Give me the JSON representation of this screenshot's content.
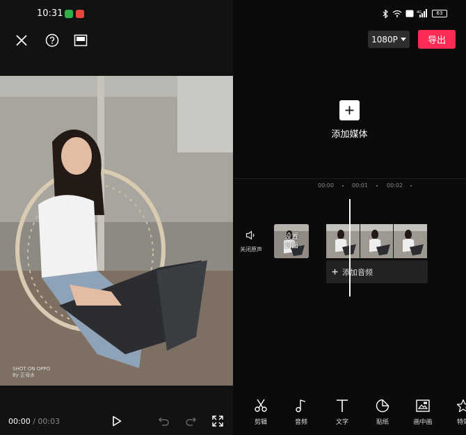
{
  "status_bar": {
    "time": "10:31",
    "battery": "63"
  },
  "preview": {
    "watermark_line1": "SHOT ON OPPO",
    "watermark_line2": "By 正母水"
  },
  "playback": {
    "current_time": "00:00",
    "separator": " / ",
    "total_time": "00:03"
  },
  "header": {
    "resolution_label": "1080P",
    "export_label": "导出"
  },
  "add_media": {
    "label": "添加媒体"
  },
  "timeline": {
    "ruler_marks": [
      "00:00",
      "00:01",
      "00:02"
    ],
    "mute_label": "关闭原声",
    "cover_label_line1": "设置",
    "cover_label_line2": "封面",
    "add_audio_label": "添加音频"
  },
  "toolbar": {
    "items": [
      {
        "label": "剪辑",
        "icon": "scissors-icon"
      },
      {
        "label": "音频",
        "icon": "music-note-icon"
      },
      {
        "label": "文字",
        "icon": "text-icon"
      },
      {
        "label": "贴纸",
        "icon": "sticker-icon"
      },
      {
        "label": "画中画",
        "icon": "picture-in-picture-icon"
      },
      {
        "label": "特效",
        "icon": "effects-star-icon"
      }
    ]
  },
  "colors": {
    "accent": "#fe2c55",
    "background": "#0b0b0b"
  }
}
